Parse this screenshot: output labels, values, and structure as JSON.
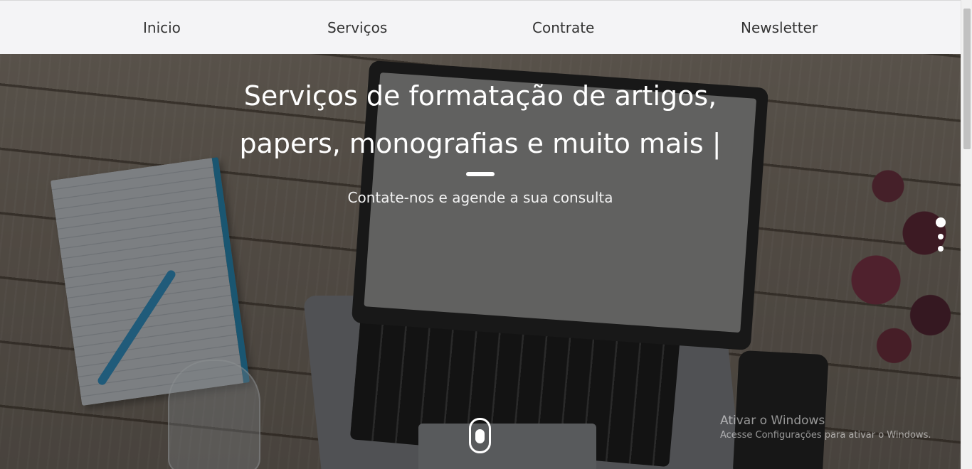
{
  "nav": {
    "items": [
      {
        "label": "Inicio"
      },
      {
        "label": "Serviços"
      },
      {
        "label": "Contrate"
      },
      {
        "label": "Newsletter"
      }
    ]
  },
  "hero": {
    "title_line1": "Serviços de formatação de artigos,",
    "title_line2": "papers, monografias e muito mais |",
    "subtitle": "Contate-nos e agende a sua consulta",
    "slide_indicators": {
      "count": 3,
      "active_index": 0
    }
  },
  "watermark": {
    "title": "Ativar o Windows",
    "subtitle": "Acesse Configurações para ativar o Windows."
  },
  "colors": {
    "nav_background": "#f4f4f6",
    "nav_text": "#333333",
    "hero_text": "#ffffff"
  }
}
